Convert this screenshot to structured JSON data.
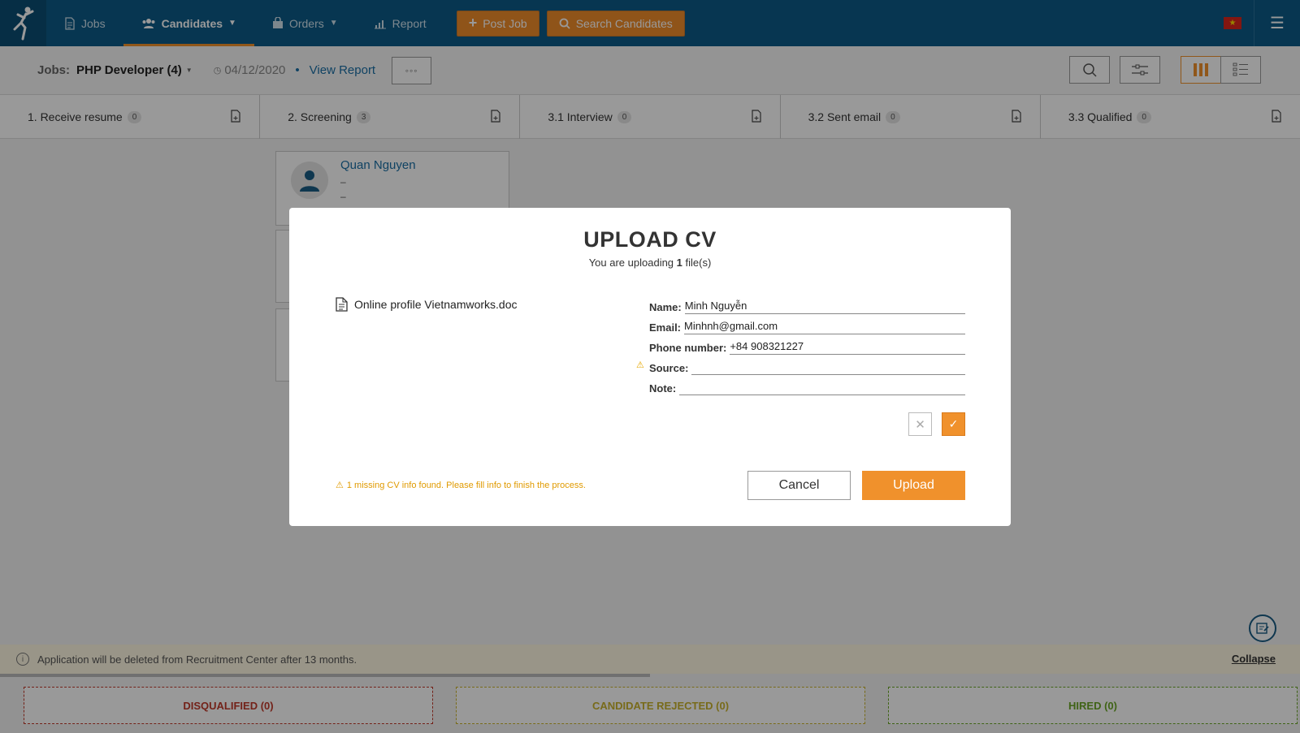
{
  "nav": {
    "items": [
      {
        "label": "Jobs",
        "icon": "document-icon"
      },
      {
        "label": "Candidates",
        "icon": "users-icon"
      },
      {
        "label": "Orders",
        "icon": "bag-icon"
      },
      {
        "label": "Report",
        "icon": "chart-icon"
      }
    ],
    "post_job": "Post Job",
    "search_candidates": "Search Candidates"
  },
  "subheader": {
    "jobs_label": "Jobs:",
    "job_name": "PHP Developer (4)",
    "date": "04/12/2020",
    "separator": "•",
    "view_report": "View Report",
    "more": "◦◦◦"
  },
  "stages": [
    {
      "label": "1. Receive resume",
      "count": "0"
    },
    {
      "label": "2. Screening",
      "count": "3"
    },
    {
      "label": "3.1 Interview",
      "count": "0"
    },
    {
      "label": "3.2 Sent email",
      "count": "0"
    },
    {
      "label": "3.3 Qualified",
      "count": "0"
    }
  ],
  "card": {
    "name": "Quan Nguyen",
    "line1": "–",
    "line2": "–"
  },
  "notice": {
    "text": "Application will be deleted from Recruitment Center after 13 months.",
    "collapse": "Collapse"
  },
  "zones": {
    "disqualified": "DISQUALIFIED (0)",
    "rejected": "CANDIDATE REJECTED (0)",
    "hired": "HIRED (0)"
  },
  "modal": {
    "title": "UPLOAD CV",
    "sub_prefix": "You are uploading ",
    "sub_count": "1",
    "sub_suffix": " file(s)",
    "file_name": "Online profile Vietnamworks.doc",
    "fields": {
      "name_label": "Name:",
      "name_value": "Minh Nguyễn",
      "email_label": "Email:",
      "email_value": "Minhnh@gmail.com",
      "phone_label": "Phone number:",
      "phone_value": "+84 908321227",
      "source_label": "Source:",
      "source_value": "",
      "note_label": "Note:",
      "note_value": ""
    },
    "missing_msg": "1 missing CV info found. Please fill info to finish the process.",
    "cancel": "Cancel",
    "upload": "Upload"
  },
  "colors": {
    "nav_bg": "#0c5b88",
    "accent": "#f0912c",
    "link": "#1a6fa5",
    "disqualified": "#c0392b",
    "rejected": "#c9b22c",
    "hired": "#6aa626"
  }
}
